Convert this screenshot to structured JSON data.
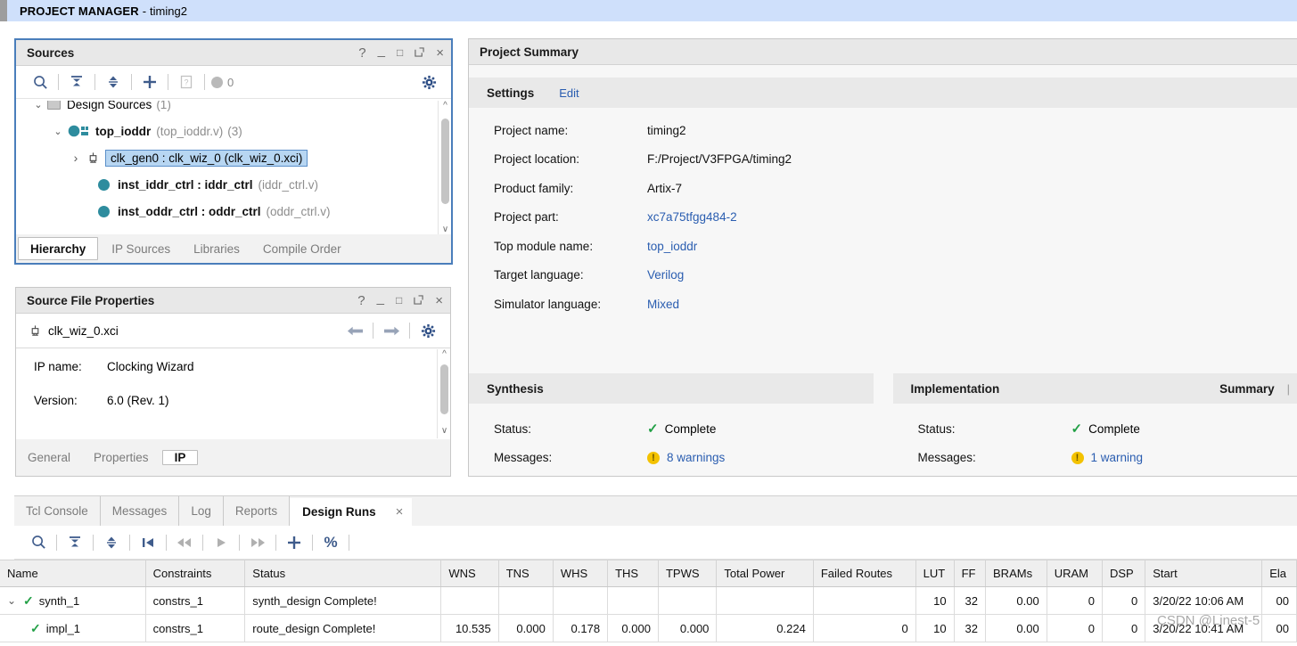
{
  "header": {
    "app_label": "PROJECT MANAGER",
    "separator": "-",
    "project": "timing2"
  },
  "sources_panel": {
    "title": "Sources",
    "window_buttons": [
      "?",
      "_",
      "□",
      "↗",
      "×"
    ],
    "toolbar": {
      "search": "search-icon",
      "collapse_all": "collapse-all-icon",
      "expand_all": "expand-collapse-icon",
      "add_sources": "plus-icon",
      "report": "report-icon",
      "status_count": "0",
      "settings": "gear-icon"
    },
    "tree": [
      {
        "label": "Design Sources",
        "suffix": "(1)",
        "depth": 0,
        "chevron": "⌄",
        "icon": "folder",
        "bold": false,
        "selected": false
      },
      {
        "label": "top_ioddr",
        "file": "(top_ioddr.v)",
        "suffix": "(3)",
        "depth": 1,
        "chevron": "⌄",
        "icon": "module",
        "bold": true,
        "selected": false
      },
      {
        "label": "clk_gen0 : clk_wiz_0 (clk_wiz_0.xci)",
        "depth": 2,
        "chevron": "›",
        "icon": "ip",
        "bold": false,
        "selected": true
      },
      {
        "label": "inst_iddr_ctrl : iddr_ctrl",
        "file": "(iddr_ctrl.v)",
        "depth": 2,
        "chevron": "",
        "icon": "module-dot",
        "bold": true,
        "selected": false
      },
      {
        "label": "inst_oddr_ctrl : oddr_ctrl",
        "file": "(oddr_ctrl.v)",
        "depth": 2,
        "chevron": "",
        "icon": "module-dot",
        "bold": true,
        "selected": false
      }
    ],
    "tabs": [
      {
        "label": "Hierarchy",
        "active": true
      },
      {
        "label": "IP Sources",
        "active": false
      },
      {
        "label": "Libraries",
        "active": false
      },
      {
        "label": "Compile Order",
        "active": false
      }
    ]
  },
  "properties_panel": {
    "title": "Source File Properties",
    "window_buttons": [
      "?",
      "_",
      "□",
      "↗",
      "×"
    ],
    "file_name": "clk_wiz_0.xci",
    "nav": {
      "back": "arrow-left-icon",
      "forward": "arrow-right-icon",
      "settings": "gear-icon"
    },
    "fields": [
      {
        "key": "IP name:",
        "value": "Clocking Wizard"
      },
      {
        "key": "Version:",
        "value": "6.0 (Rev. 1)"
      }
    ],
    "tabs": [
      {
        "label": "General",
        "active": false
      },
      {
        "label": "Properties",
        "active": false
      },
      {
        "label": "IP",
        "active": true
      }
    ]
  },
  "project_summary": {
    "title": "Project Summary",
    "settings_section": {
      "heading": "Settings",
      "edit_link": "Edit",
      "rows": [
        {
          "key": "Project name:",
          "value": "timing2",
          "link": false
        },
        {
          "key": "Project location:",
          "value": "F:/Project/V3FPGA/timing2",
          "link": false
        },
        {
          "key": "Product family:",
          "value": "Artix-7",
          "link": false
        },
        {
          "key": "Project part:",
          "value": "xc7a75tfgg484-2",
          "link": true
        },
        {
          "key": "Top module name:",
          "value": "top_ioddr",
          "link": true
        },
        {
          "key": "Target language:",
          "value": "Verilog",
          "link": true
        },
        {
          "key": "Simulator language:",
          "value": "Mixed",
          "link": true
        }
      ]
    },
    "synthesis": {
      "heading": "Synthesis",
      "status_label": "Status:",
      "status_value": "Complete",
      "messages_label": "Messages:",
      "messages_value": "8 warnings"
    },
    "implementation": {
      "heading": "Implementation",
      "summary_link": "Summary",
      "status_label": "Status:",
      "status_value": "Complete",
      "messages_label": "Messages:",
      "messages_value": "1 warning"
    }
  },
  "bottom_panel": {
    "tabs": [
      {
        "label": "Tcl Console",
        "active": false
      },
      {
        "label": "Messages",
        "active": false
      },
      {
        "label": "Log",
        "active": false
      },
      {
        "label": "Reports",
        "active": false
      },
      {
        "label": "Design Runs",
        "active": true
      }
    ],
    "close_icon": "×",
    "toolbar": [
      "search-icon",
      "collapse-all-icon",
      "expand-collapse-icon",
      "skip-start-icon",
      "rewind-icon",
      "play-icon",
      "fast-forward-icon",
      "plus-icon",
      "percent-icon"
    ],
    "table": {
      "columns": [
        "Name",
        "Constraints",
        "Status",
        "WNS",
        "TNS",
        "WHS",
        "THS",
        "TPWS",
        "Total Power",
        "Failed Routes",
        "LUT",
        "FF",
        "BRAMs",
        "URAM",
        "DSP",
        "Start",
        "Ela"
      ],
      "rows": [
        {
          "chevron": "⌄",
          "check": true,
          "indent": 0,
          "Name": "synth_1",
          "Constraints": "constrs_1",
          "Status": "synth_design Complete!",
          "WNS": "",
          "TNS": "",
          "WHS": "",
          "THS": "",
          "TPWS": "",
          "Total Power": "",
          "Failed Routes": "",
          "LUT": "10",
          "FF": "32",
          "BRAMs": "0.00",
          "URAM": "0",
          "DSP": "0",
          "Start": "3/20/22 10:06 AM",
          "Ela": "00"
        },
        {
          "chevron": "",
          "check": true,
          "indent": 1,
          "Name": "impl_1",
          "Constraints": "constrs_1",
          "Status": "route_design Complete!",
          "WNS": "10.535",
          "TNS": "0.000",
          "WHS": "0.178",
          "THS": "0.000",
          "TPWS": "0.000",
          "Total Power": "0.224",
          "Failed Routes": "0",
          "LUT": "10",
          "FF": "32",
          "BRAMs": "0.00",
          "URAM": "0",
          "DSP": "0",
          "Start": "3/20/22 10:41 AM",
          "Ela": "00"
        }
      ]
    }
  },
  "watermark": {
    "line1": "CSDN @Linest-5",
    "line2": "CSDN @Linest-5"
  },
  "colors": {
    "header_bg": "#cfe0fb",
    "focus_border": "#4a7ebb",
    "link": "#2a5db0",
    "check_green": "#22a046",
    "warn_yellow": "#f3c200",
    "teal_dot": "#2e8c9e"
  }
}
